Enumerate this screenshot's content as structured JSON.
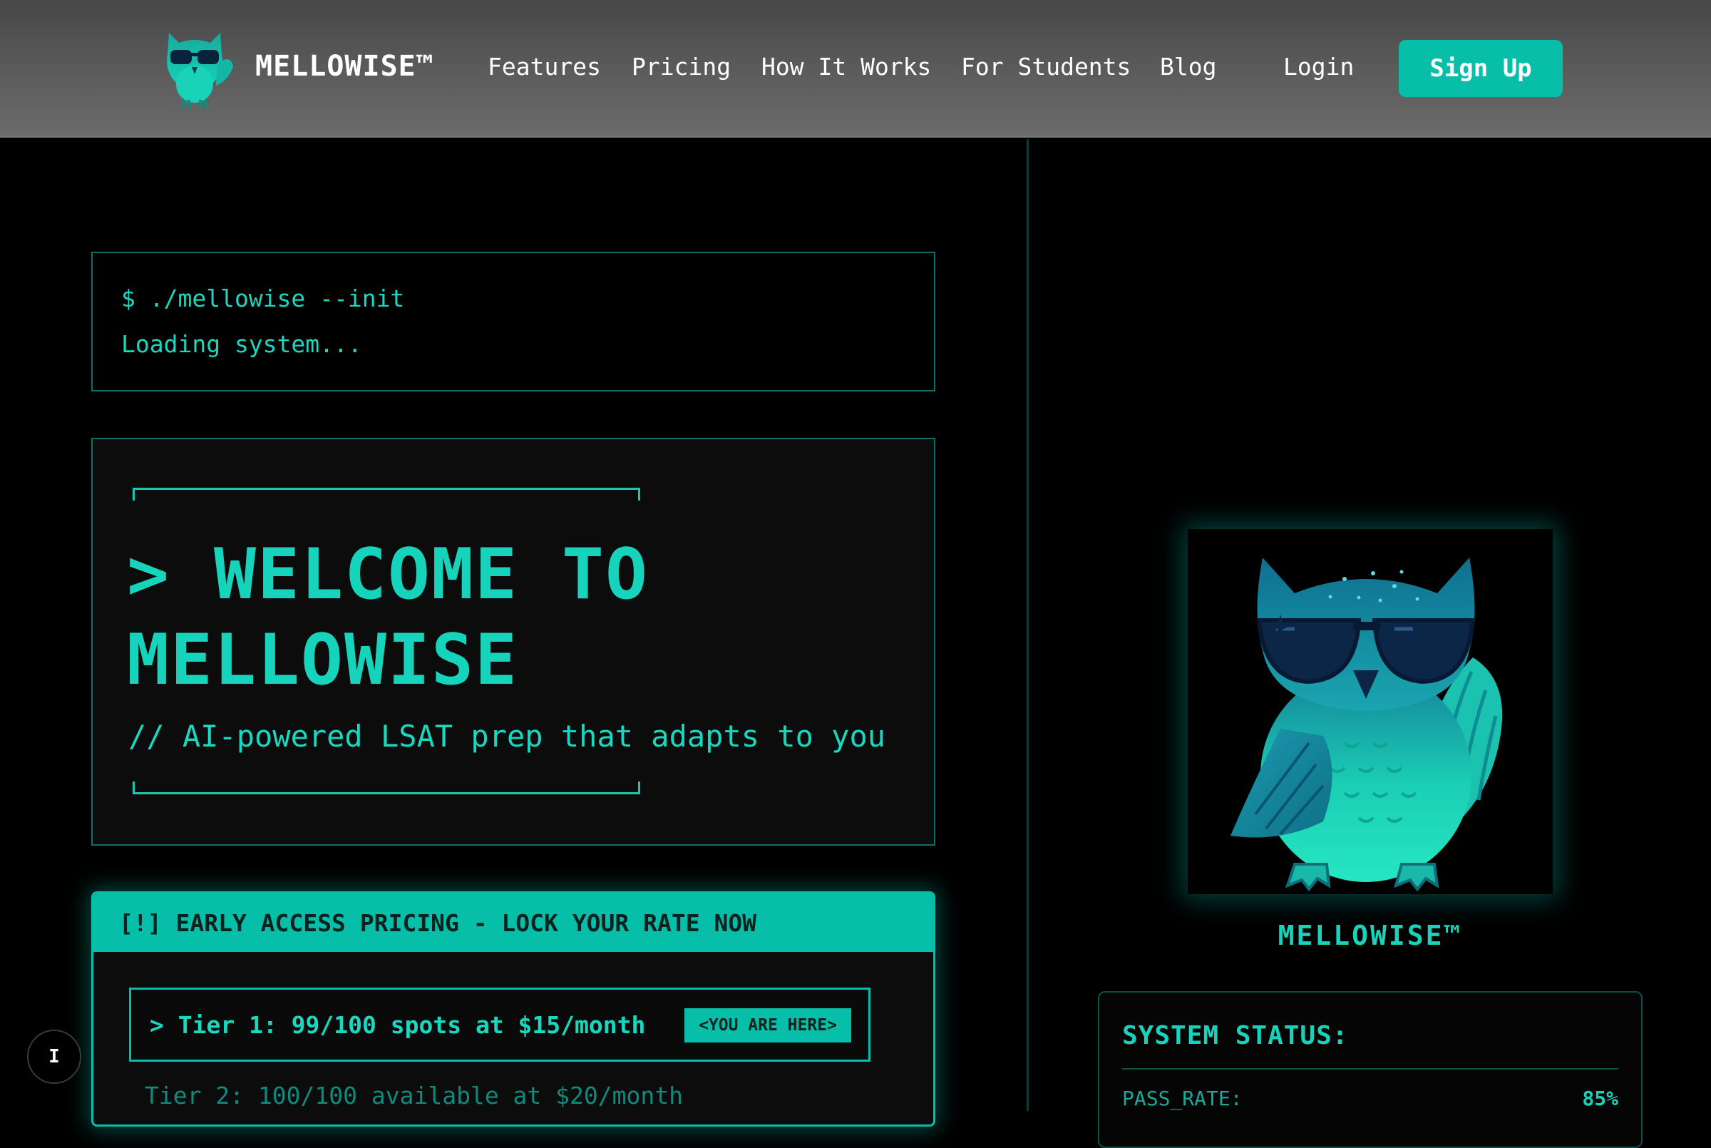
{
  "nav": {
    "brand": "MELLOWISE™",
    "links": [
      "Features",
      "Pricing",
      "How It Works",
      "For Students",
      "Blog"
    ],
    "login": "Login",
    "signup": "Sign Up"
  },
  "terminal": {
    "command": "$ ./mellowise --init",
    "status": "Loading system..."
  },
  "welcome": {
    "title_line1": "> WELCOME TO",
    "title_line2": "MELLOWISE",
    "subtitle": "// AI-powered LSAT prep that adapts to you"
  },
  "pricing": {
    "header": "[!] EARLY ACCESS PRICING - LOCK YOUR RATE NOW",
    "tier1": "> Tier 1: 99/100 spots at $15/month",
    "tier1_badge": "<YOU ARE HERE>",
    "tier2": "Tier 2: 100/100 available at $20/month"
  },
  "mascot": {
    "caption": "MELLOWISE™"
  },
  "system_status": {
    "title": "SYSTEM STATUS:",
    "rows": [
      {
        "label": "PASS_RATE:",
        "value": "85%"
      }
    ]
  },
  "floating_button": {
    "label": "I"
  },
  "colors": {
    "accent": "#07bfa8",
    "accent_text": "#19d8c0",
    "background": "#000000",
    "nav_background": "#5a5a5a"
  }
}
